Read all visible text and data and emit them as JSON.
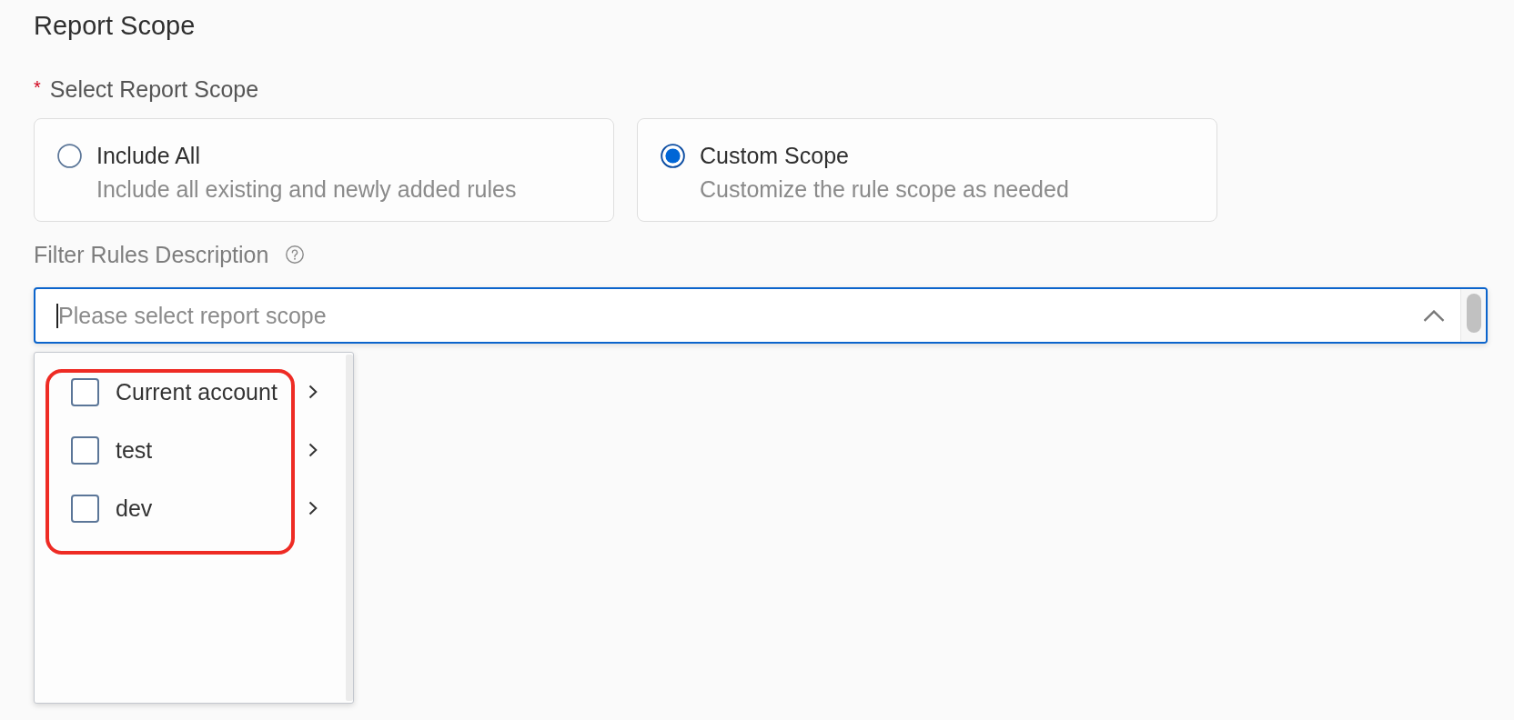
{
  "section": {
    "title": "Report Scope"
  },
  "scope_field": {
    "required_mark": "*",
    "label": "Select Report Scope",
    "options": [
      {
        "title": "Include All",
        "description": "Include all existing and newly added rules",
        "selected": false
      },
      {
        "title": "Custom Scope",
        "description": "Customize the rule scope as needed",
        "selected": true
      }
    ]
  },
  "filter_field": {
    "label": "Filter Rules Description",
    "select": {
      "placeholder": "Please select report scope",
      "expanded": true,
      "highlighted": true,
      "options": [
        {
          "label": "Current account",
          "checked": false,
          "has_children": true
        },
        {
          "label": "test",
          "checked": false,
          "has_children": true
        },
        {
          "label": "dev",
          "checked": false,
          "has_children": true
        }
      ]
    }
  }
}
